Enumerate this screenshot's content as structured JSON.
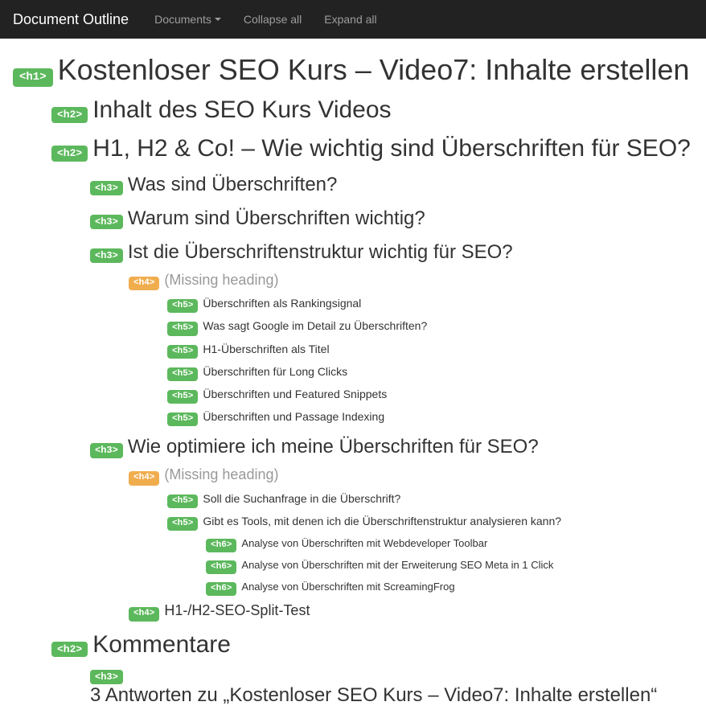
{
  "navbar": {
    "brand": "Document Outline",
    "documents": "Documents",
    "collapse": "Collapse all",
    "expand": "Expand all"
  },
  "outline": [
    {
      "level": 1,
      "tag": "<h1>",
      "text": "Kostenloser SEO Kurs – Video7: Inhalte erstellen",
      "missing": false
    },
    {
      "level": 2,
      "tag": "<h2>",
      "text": "Inhalt des SEO Kurs Videos",
      "missing": false
    },
    {
      "level": 2,
      "tag": "<h2>",
      "text": "H1, H2 & Co! – Wie wichtig sind Überschriften für SEO?",
      "missing": false
    },
    {
      "level": 3,
      "tag": "<h3>",
      "text": "Was sind Überschriften?",
      "missing": false
    },
    {
      "level": 3,
      "tag": "<h3>",
      "text": "Warum sind Überschriften wichtig?",
      "missing": false
    },
    {
      "level": 3,
      "tag": "<h3>",
      "text": "Ist die Überschriftenstruktur wichtig für SEO?",
      "missing": false
    },
    {
      "level": 4,
      "tag": "<h4>",
      "text": "(Missing heading)",
      "missing": true
    },
    {
      "level": 5,
      "tag": "<h5>",
      "text": "Überschriften als Rankingsignal",
      "missing": false
    },
    {
      "level": 5,
      "tag": "<h5>",
      "text": "Was sagt Google im Detail zu Überschriften?",
      "missing": false
    },
    {
      "level": 5,
      "tag": "<h5>",
      "text": "H1-Überschriften als Titel",
      "missing": false
    },
    {
      "level": 5,
      "tag": "<h5>",
      "text": "Überschriften für Long Clicks",
      "missing": false
    },
    {
      "level": 5,
      "tag": "<h5>",
      "text": "Überschriften und Featured Snippets",
      "missing": false
    },
    {
      "level": 5,
      "tag": "<h5>",
      "text": "Überschriften und Passage Indexing",
      "missing": false
    },
    {
      "level": 3,
      "tag": "<h3>",
      "text": "Wie optimiere ich meine Überschriften für SEO?",
      "missing": false
    },
    {
      "level": 4,
      "tag": "<h4>",
      "text": "(Missing heading)",
      "missing": true
    },
    {
      "level": 5,
      "tag": "<h5>",
      "text": "Soll die Suchanfrage in die Überschrift?",
      "missing": false
    },
    {
      "level": 5,
      "tag": "<h5>",
      "text": "Gibt es Tools, mit denen ich die Überschriftenstruktur analysieren kann?",
      "missing": false
    },
    {
      "level": 6,
      "tag": "<h6>",
      "text": "Analyse von Überschriften mit Webdeveloper Toolbar",
      "missing": false
    },
    {
      "level": 6,
      "tag": "<h6>",
      "text": "Analyse von Überschriften mit der Erweiterung SEO Meta in 1 Click",
      "missing": false
    },
    {
      "level": 6,
      "tag": "<h6>",
      "text": "Analyse von Überschriften mit ScreamingFrog",
      "missing": false
    },
    {
      "level": 4,
      "tag": "<h4>",
      "text": "H1-/H2-SEO-Split-Test",
      "missing": false
    },
    {
      "level": 2,
      "tag": "<h2>",
      "text": "Kommentare",
      "missing": false
    },
    {
      "level": 3,
      "tag": "<h3>",
      "text": "3 Antworten zu „Kostenloser SEO Kurs – Video7: Inhalte erstellen“",
      "missing": false
    }
  ]
}
